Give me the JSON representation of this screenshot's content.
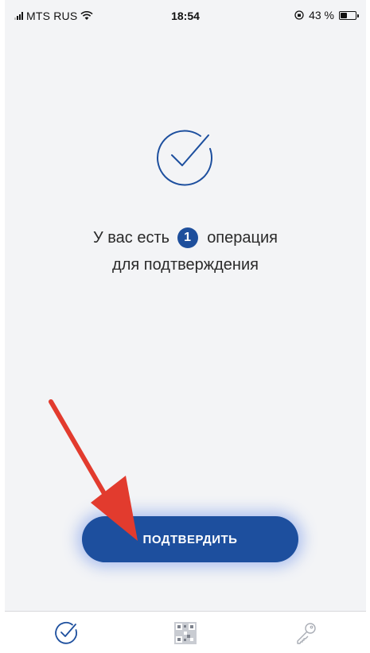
{
  "status_bar": {
    "carrier": "MTS RUS",
    "time": "18:54",
    "battery": "43 %",
    "battery_level": 0.43
  },
  "main": {
    "message_prefix": "У вас есть",
    "operations_count": "1",
    "message_suffix": "операция",
    "message_line2": "для подтверждения"
  },
  "confirm_button": {
    "label": "ПОДТВЕРДИТЬ"
  },
  "tab_bar": {
    "items": [
      {
        "icon": "check-circle-icon",
        "active": true
      },
      {
        "icon": "qr-code-icon",
        "active": false
      },
      {
        "icon": "key-icon",
        "active": false
      }
    ]
  },
  "colors": {
    "accent": "#1d4f9e",
    "annotation_arrow": "#e23b2e",
    "background": "#f3f4f6"
  }
}
